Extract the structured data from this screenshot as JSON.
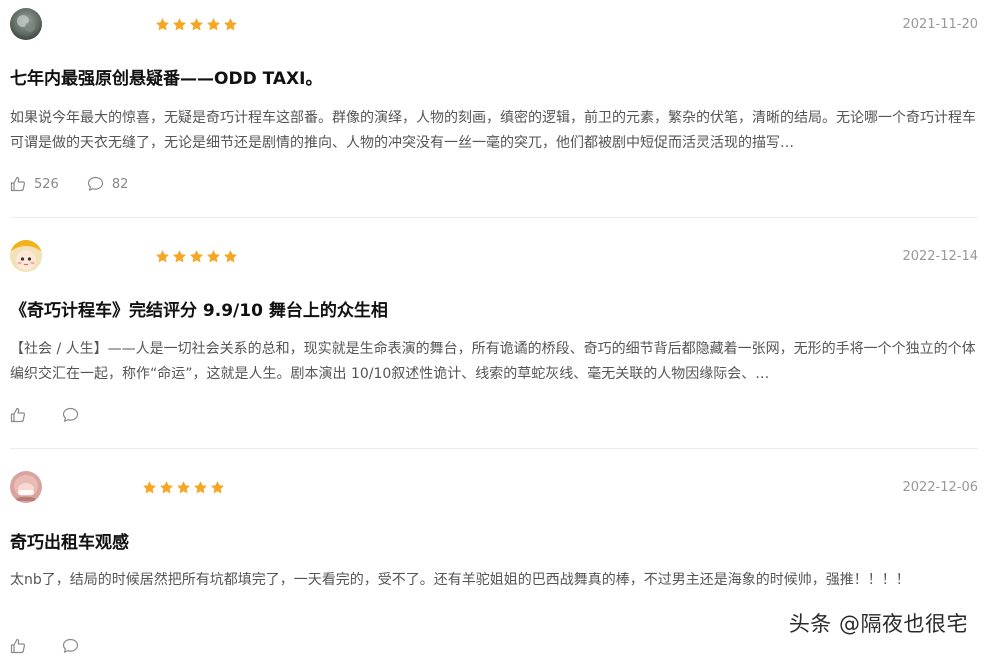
{
  "reviews": [
    {
      "rating": 5,
      "date": "2021-11-20",
      "title": "七年内最强原创悬疑番——ODD TAXI。",
      "body": "如果说今年最大的惊喜，无疑是奇巧计程车这部番。群像的演绎，人物的刻画，缜密的逻辑，前卫的元素，繁杂的伏笔，清晰的结局。无论哪一个奇巧计程车可谓是做的天衣无缝了，无论是细节还是剧情的推向、人物的冲突没有一丝一毫的突兀，他们都被剧中短促而活灵活现的描写…",
      "likes": "526",
      "comments": "82"
    },
    {
      "rating": 5,
      "date": "2022-12-14",
      "title": "《奇巧计程车》完结评分 9.9/10 舞台上的众生相",
      "body": "【社会 / 人生】——人是一切社会关系的总和，现实就是生命表演的舞台，所有诡谲的桥段、奇巧的细节背后都隐藏着一张网，无形的手将一个个独立的个体编织交汇在一起，称作“命运”，这就是人生。剧本演出 10/10叙述性诡计、线索的草蛇灰线、毫无关联的人物因缘际会、…",
      "likes": "",
      "comments": ""
    },
    {
      "rating": 5,
      "date": "2022-12-06",
      "title": "奇巧出租车观感",
      "body": "太nb了，结局的时候居然把所有坑都填完了，一天看完的，受不了。还有羊驼姐姐的巴西战舞真的棒，不过男主还是海象的时候帅，强推！！！！",
      "likes": "",
      "comments": ""
    }
  ],
  "watermark": "头条 @隔夜也很宅",
  "colors": {
    "star": "#f5a623",
    "divider": "#ececec",
    "date": "#999999",
    "action_icon": "#8a8a8a"
  },
  "icons": {
    "like": "thumbs-up-icon",
    "comment": "comment-bubble-icon",
    "star": "star-icon"
  }
}
